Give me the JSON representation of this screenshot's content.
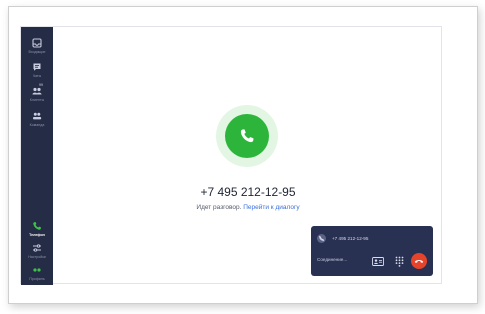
{
  "sidebar": {
    "items": [
      {
        "label": "Входящие",
        "icon": "inbox-icon"
      },
      {
        "label": "Чаты",
        "icon": "chat-icon"
      },
      {
        "label": "Клиенты",
        "icon": "clients-icon",
        "badge": "99"
      },
      {
        "label": "Команда",
        "icon": "team-icon"
      },
      {
        "label": "Телефон",
        "icon": "phone-icon",
        "active": true
      },
      {
        "label": "Настройки",
        "icon": "settings-icon"
      },
      {
        "label": "Профиль",
        "icon": "profile-icon"
      }
    ]
  },
  "call": {
    "number": "+7 495 212-12-95",
    "status": "Идет разговор.",
    "link": "Перейти к диалогу"
  },
  "mini_call": {
    "number": "+7 495 212-12-95",
    "status": "Соединение..."
  },
  "colors": {
    "sidebar_bg": "#252c45",
    "call_green": "#2db53b",
    "hangup_red": "#e5442b",
    "link_blue": "#3b6fd8",
    "widget_bg": "#293152"
  }
}
